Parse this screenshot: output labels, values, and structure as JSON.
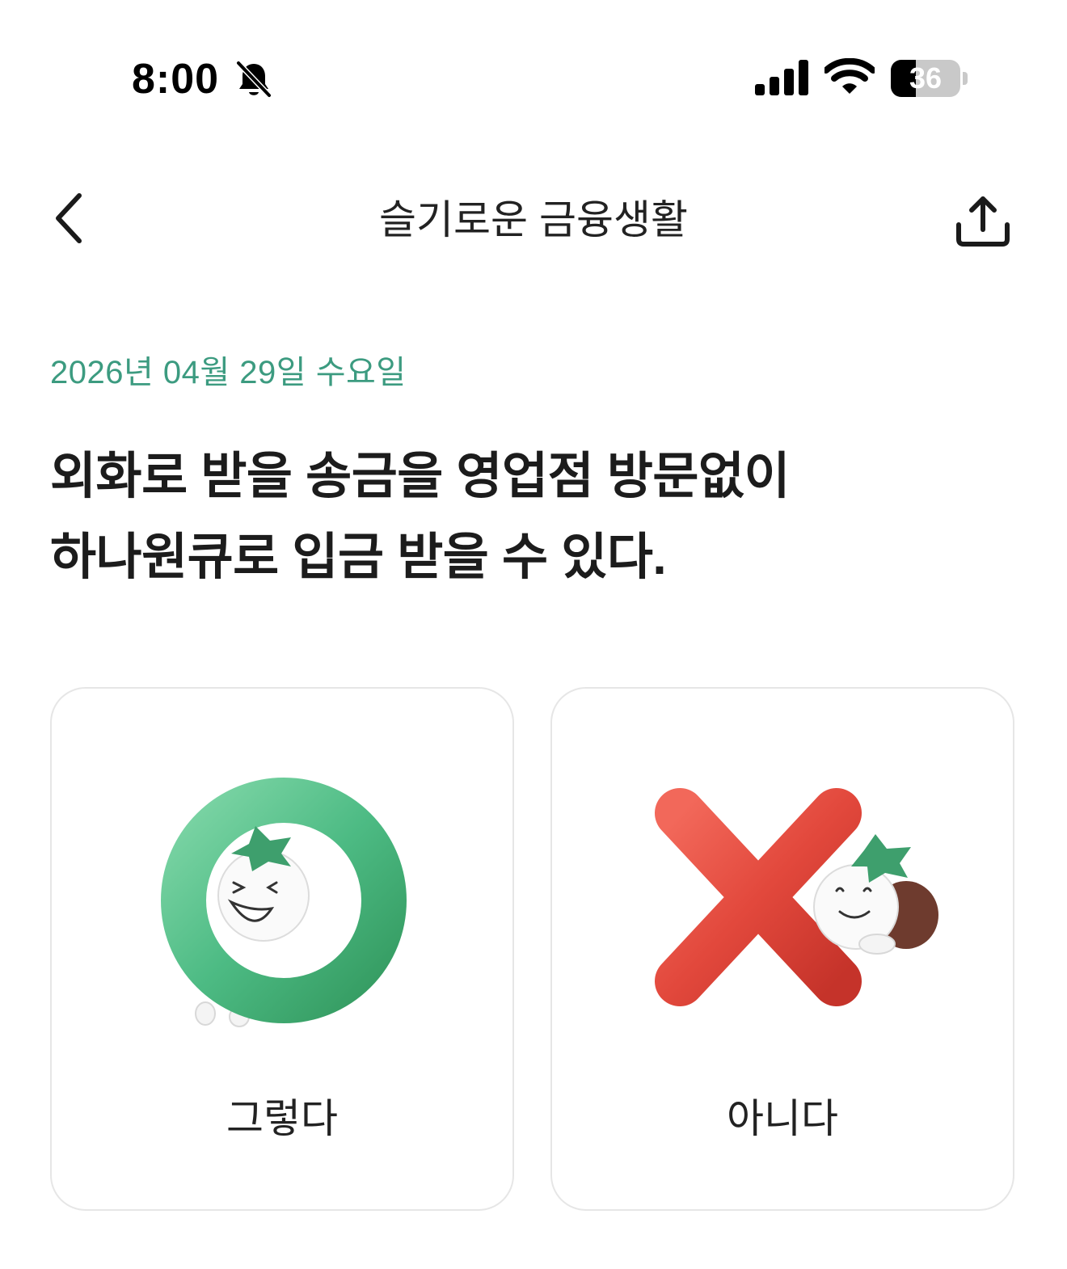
{
  "status_bar": {
    "time": "8:00",
    "battery_level": "36",
    "battery_fraction": 0.36,
    "icons": [
      "bell-muted-icon",
      "signal-icon",
      "wifi-icon",
      "battery-icon"
    ]
  },
  "nav": {
    "title": "슬기로운 금융생활",
    "icons": [
      "chevron-left-icon",
      "share-icon"
    ]
  },
  "content": {
    "date": "2026년 04월 29일 수요일",
    "question_lines": [
      "외화로 받을 송금을 영업점 방문없이",
      "하나원큐로 입금 받을 수 있다."
    ]
  },
  "answers": [
    {
      "label": "그렇다",
      "icon": "o-mark-icon",
      "color": "#4dbb84"
    },
    {
      "label": "아니다",
      "icon": "x-mark-icon",
      "color": "#e2483c"
    }
  ],
  "colors": {
    "accent": "#3c9b80",
    "yes": "#4dbb84",
    "no": "#e2483c",
    "card_border": "#e6e6e6"
  }
}
